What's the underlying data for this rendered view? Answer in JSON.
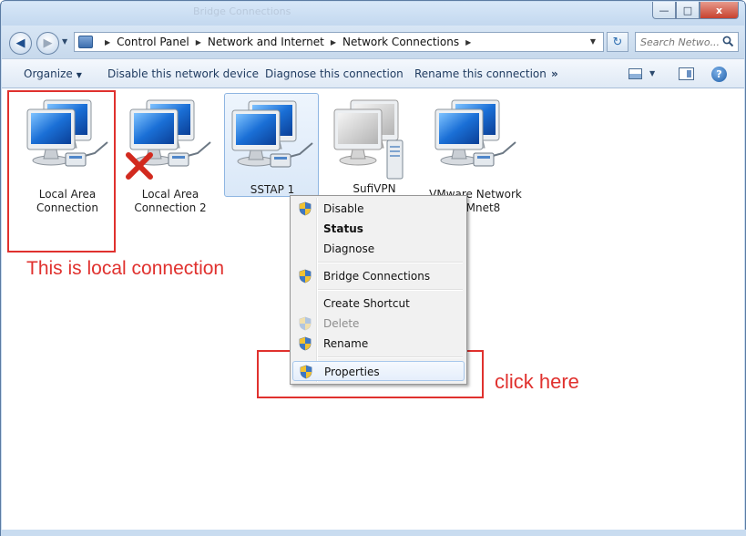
{
  "window": {
    "ghost_title": "Bridge Connections",
    "buttons": {
      "minimize": "—",
      "maximize": "□",
      "close": "x"
    }
  },
  "address": {
    "crumbs": [
      "Control Panel",
      "Network and Internet",
      "Network Connections"
    ],
    "search_placeholder": "Search Netwo..."
  },
  "toolbar": {
    "organize": "Organize",
    "disable": "Disable this network device",
    "diagnose": "Diagnose this connection",
    "rename": "Rename this connection",
    "more": "»",
    "help": "?"
  },
  "connections": [
    {
      "label": "Local Area\nConnection",
      "icon": "network-monitor-icon",
      "state": "normal"
    },
    {
      "label": "Local Area\nConnection 2",
      "icon": "network-monitor-icon",
      "state": "disconnected"
    },
    {
      "label": "SSTAP 1",
      "icon": "network-monitor-icon",
      "state": "selected"
    },
    {
      "label": "SufiVPN",
      "icon": "vpn-server-icon",
      "state": "grey"
    },
    {
      "label": "VMware Network\nr VMnet8",
      "icon": "network-monitor-icon",
      "state": "normal"
    }
  ],
  "context_menu": {
    "items": [
      {
        "label": "Disable",
        "shield": true,
        "bold": false,
        "disabled": false
      },
      {
        "label": "Status",
        "shield": false,
        "bold": true,
        "disabled": false
      },
      {
        "label": "Diagnose",
        "shield": false,
        "bold": false,
        "disabled": false
      },
      {
        "label": "Bridge Connections",
        "shield": true,
        "bold": false,
        "disabled": false
      },
      {
        "label": "Create Shortcut",
        "shield": false,
        "bold": false,
        "disabled": false
      },
      {
        "label": "Delete",
        "shield": true,
        "bold": false,
        "disabled": true
      },
      {
        "label": "Rename",
        "shield": true,
        "bold": false,
        "disabled": false
      },
      {
        "label": "Properties",
        "shield": true,
        "bold": false,
        "disabled": false
      }
    ]
  },
  "annotations": {
    "local_text": "This is local connection",
    "click_text": "click here",
    "color": "#e0312e"
  }
}
